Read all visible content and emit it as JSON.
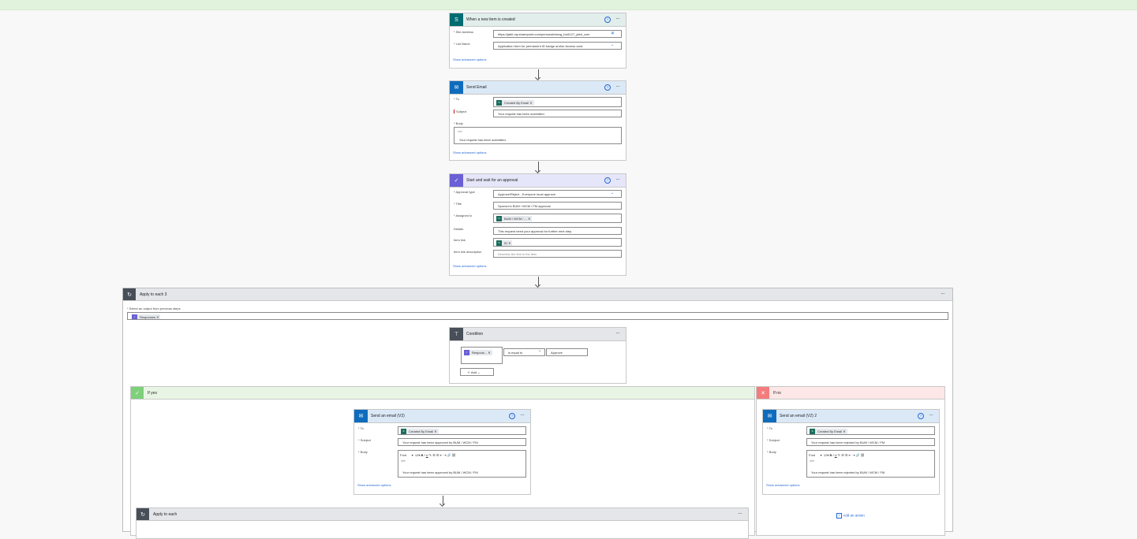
{
  "trigger": {
    "title": "When a new item is created",
    "site_label": "* Site Address",
    "site_value": "https://jabil-my.sharepoint.com/personal/xiang_hai1127_jabil_com",
    "list_label": "* List Name",
    "list_value": "Application form for permanent ID badge and/or Access card.",
    "advanced": "Show advanced options"
  },
  "send_email": {
    "title": "Send Email",
    "to_label": "* To",
    "to_token": "Created By Email",
    "subject_label": "Subject",
    "subject_value": "Your request has been submitted",
    "body_label": "* Body",
    "body_code": "</>",
    "body_value": "Your request has been submitted.",
    "advanced": "Show advanced options"
  },
  "approval": {
    "title": "Start and wait for an approval",
    "type_label": "* Approval type",
    "type_value": "Approve/Reject - Everyone must approve",
    "title_label": "* Title",
    "title_value": "Sponsor's BUM / WCM / FM approval",
    "assigned_label": "* Assigned to",
    "assigned_token": "BUM / WCM / ...",
    "details_label": "Details",
    "details_value": "This request need your approval for further next step.",
    "link_label": "Item link",
    "link_token": "ID",
    "linkdesc_label": "Item link description",
    "linkdesc_placeholder": "Describe the link to the item",
    "advanced": "Show advanced options"
  },
  "apply_each3": {
    "title": "Apply to each 3",
    "select_label": "* Select an output from previous steps",
    "token": "Responses"
  },
  "condition": {
    "title": "Condition",
    "token": "Respons...",
    "operator": "is equal to",
    "value": "Approve",
    "add_label": "Add"
  },
  "if_yes": {
    "label": "If yes",
    "email": {
      "title": "Send an email (V2)",
      "to_label": "* To",
      "to_token": "Created By Email",
      "subject_label": "* Subject",
      "subject_value": "Your request has been approved by BUM / WCM / FM",
      "body_label": "* Body",
      "font_label": "Font",
      "size_label": "12",
      "body_value": "Your request has been approved by BUM / WCM / FM",
      "advanced": "Show advanced options"
    },
    "apply_each": "Apply to each"
  },
  "if_no": {
    "label": "If no",
    "email": {
      "title": "Send an email (V2) 2",
      "to_label": "* To",
      "to_token": "Created By Email",
      "subject_label": "* Subject",
      "subject_value": "Your request has been rejected by BUM / WCM / FM",
      "body_label": "* Body",
      "font_label": "Font",
      "size_label": "12",
      "body_value": "Your request has been rejected by BUM / WCM / FM",
      "advanced": "Show advanced options"
    },
    "add_action": "Add an action"
  },
  "colors": {
    "sharepoint": "#036c70",
    "outlook": "#0f6cbd",
    "approval": "#6b5fd6",
    "control": "#484f58",
    "yes": "#7ed07a",
    "no": "#f47c7c"
  }
}
